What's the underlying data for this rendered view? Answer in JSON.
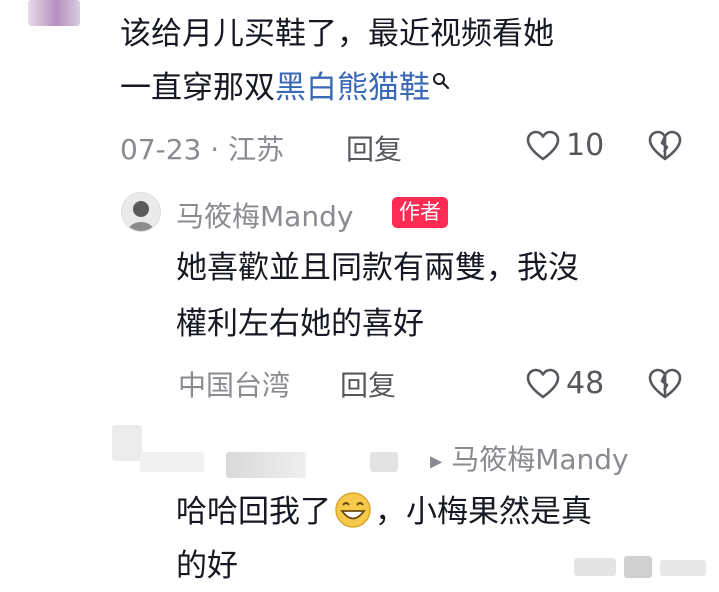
{
  "comment1": {
    "text_line1": "该给月儿买鞋了，最近视频看她",
    "text_line2_prefix": "一直穿那双",
    "text_line2_link": "黑白熊猫鞋",
    "date": "07-23",
    "location": "江苏",
    "reply_label": "回复",
    "likes": "10"
  },
  "reply1": {
    "author": "马筱梅Mandy",
    "badge": "作者",
    "text_line1": "她喜歡並且同款有兩雙，我沒",
    "text_line2": "權利左右她的喜好",
    "location": "中国台湾",
    "reply_label": "回复",
    "likes": "48"
  },
  "reply2": {
    "reply_to": "马筱梅Mandy",
    "text_line1_a": "哈哈回我了",
    "text_line1_b": "，小梅果然是真",
    "text_line2": "的好"
  },
  "colors": {
    "accent": "#fe2c55",
    "link": "#3a6ab6",
    "muted": "#8a8b91",
    "text": "#161823"
  }
}
